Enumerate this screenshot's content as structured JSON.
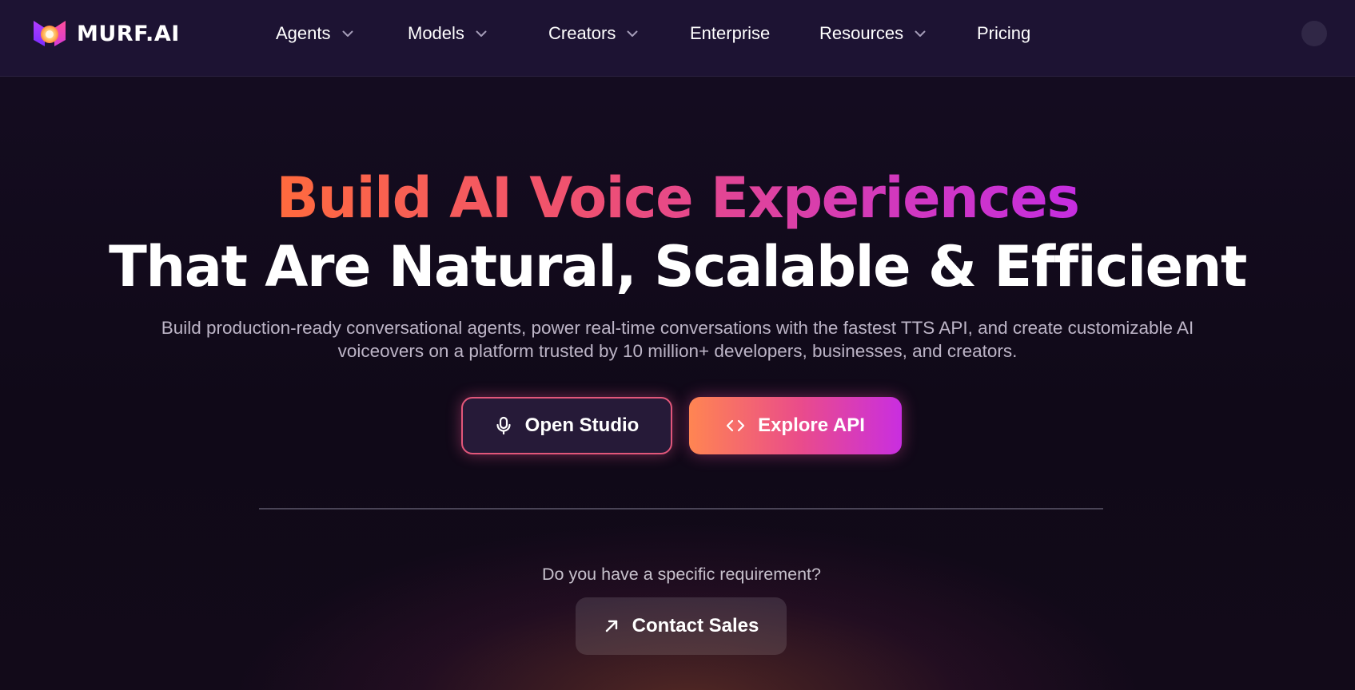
{
  "brand": {
    "name": "MURF.AI",
    "logo_icon": "murf-logo-icon"
  },
  "nav": {
    "items": [
      {
        "label": "Agents",
        "has_dropdown": true
      },
      {
        "label": "Models",
        "has_dropdown": true
      },
      {
        "label": "Creators",
        "has_dropdown": true
      },
      {
        "label": "Enterprise",
        "has_dropdown": false
      },
      {
        "label": "Resources",
        "has_dropdown": true
      },
      {
        "label": "Pricing",
        "has_dropdown": false
      }
    ],
    "dropdown_icon": "chevron-down-icon"
  },
  "hero": {
    "title_line1": "Build AI Voice Experiences",
    "title_line2": "That Are Natural, Scalable & Efficient",
    "subtitle_line1": "Build production-ready conversational agents, power real-time conversations with the fastest TTS API, and create customizable AI",
    "subtitle_line2": "voiceovers on a platform trusted by 10 million+ developers, businesses, and creators."
  },
  "cta": {
    "open_studio": {
      "label": "Open Studio",
      "icon": "microphone-icon"
    },
    "explore_api": {
      "label": "Explore API",
      "icon": "code-brackets-icon"
    }
  },
  "contact": {
    "question": "Do you have a specific requirement?",
    "button_label": "Contact Sales",
    "button_icon": "arrow-up-right-icon"
  },
  "colors": {
    "background": "#120b1c",
    "navbar": "#1d1333",
    "gradient_start": "#ff6a3d",
    "gradient_mid": "#ee4f74",
    "gradient_end": "#c52de0",
    "studio_border": "#e2577a",
    "subtitle_text": "#bdb5c7"
  }
}
